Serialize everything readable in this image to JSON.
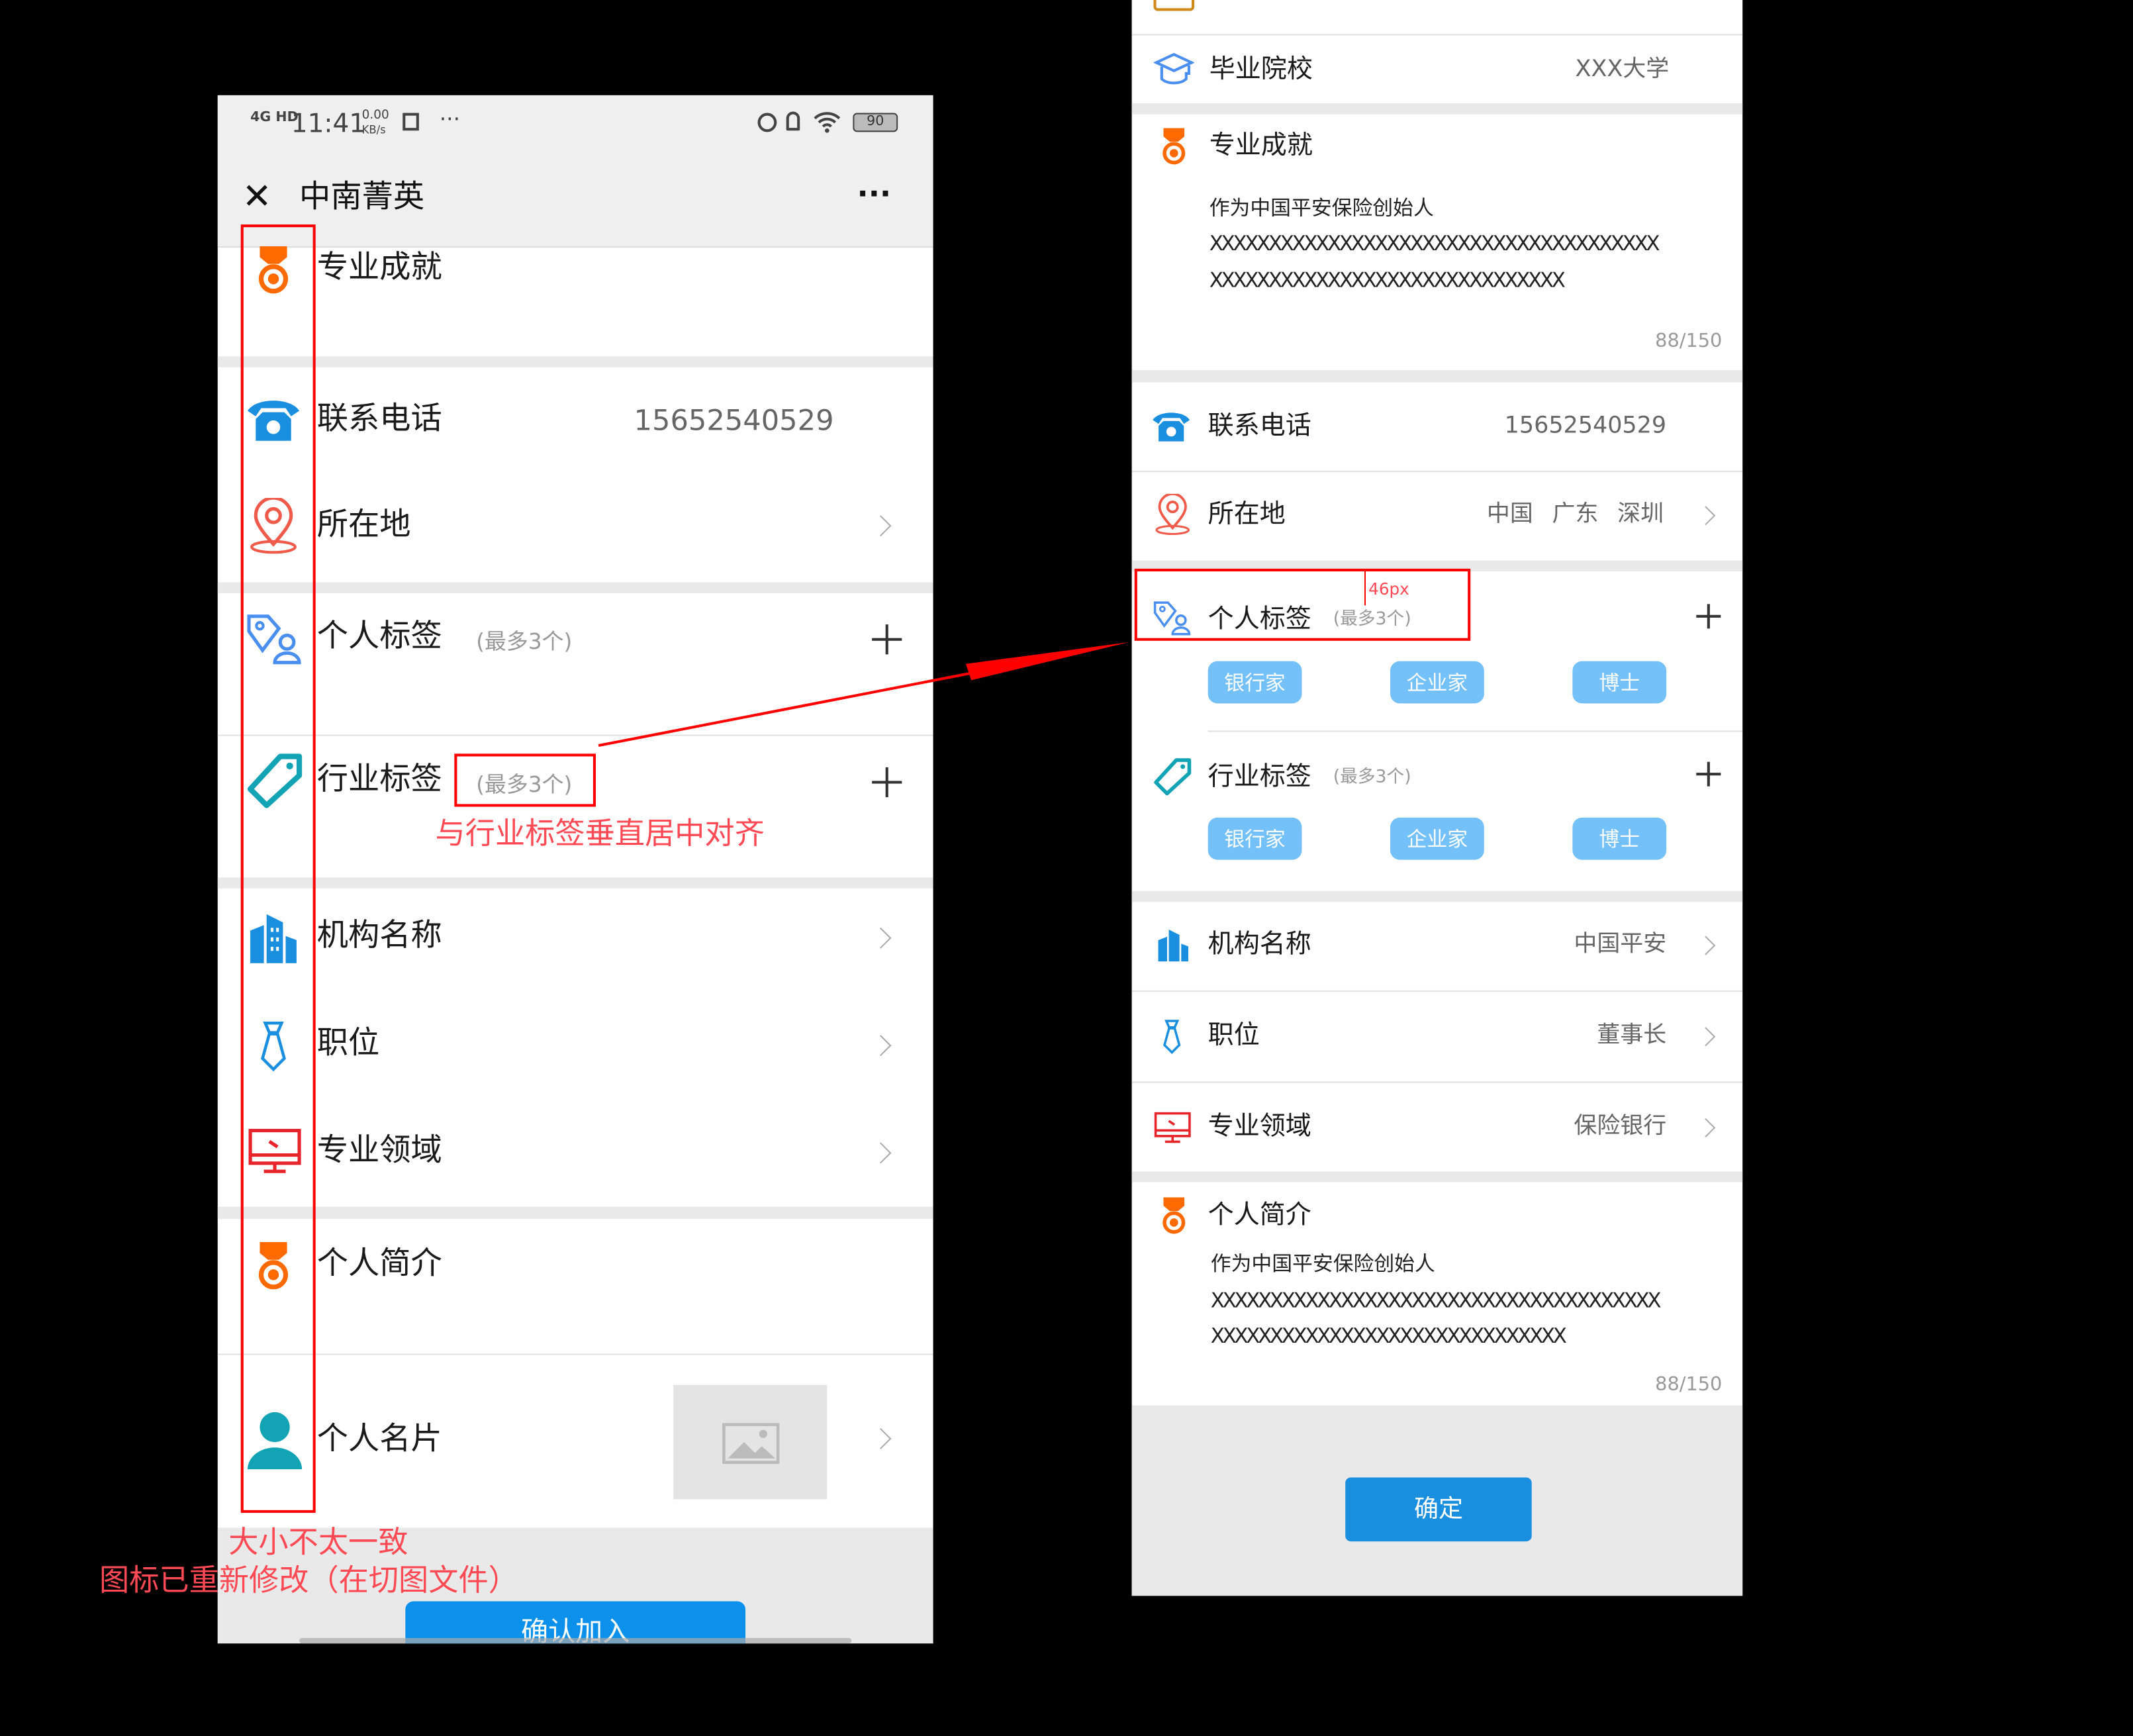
{
  "left": {
    "status": {
      "network": "4G HD",
      "time": "11:41",
      "speed_top": "0.00",
      "speed_unit": "KB/s",
      "battery": "90",
      "more": "···"
    },
    "nav": {
      "close": "✕",
      "title": "中南菁英",
      "more": "···"
    },
    "rows": {
      "achievement": "专业成就",
      "phone": "联系电话",
      "phone_value": "15652540529",
      "location": "所在地",
      "personal_tags": "个人标签",
      "personal_hint": "(最多3个)",
      "industry_tags": "行业标签",
      "industry_hint": "(最多3个)",
      "org": "机构名称",
      "position": "职位",
      "field": "专业领域",
      "intro": "个人简介",
      "card": "个人名片"
    },
    "confirm_button": "确认加入"
  },
  "annotations": {
    "align_note": "与行业标签垂直居中对齐",
    "size_note": "大小不太一致",
    "icon_note": "图标已重新修改（在切图文件）",
    "spacing": "46px",
    "color": "#ff4a55"
  },
  "right": {
    "rows": {
      "school": "毕业院校",
      "school_value": "XXX大学",
      "achievement": "专业成就",
      "achievement_lines": [
        "作为中国平安保险创始人",
        "XXXXXXXXXXXXXXXXXXXXXXXXXXXXXXXXXXXXXX",
        "XXXXXXXXXXXXXXXXXXXXXXXXXXXXXX"
      ],
      "achievement_count": "88/150",
      "phone": "联系电话",
      "phone_value": "15652540529",
      "location": "所在地",
      "location_values": [
        "中国",
        "广东",
        "深圳"
      ],
      "personal_tags": "个人标签",
      "personal_hint": "(最多3个)",
      "personal_tag_items": [
        "银行家",
        "企业家",
        "博士"
      ],
      "industry_tags": "行业标签",
      "industry_hint": "(最多3个)",
      "industry_tag_items": [
        "银行家",
        "企业家",
        "博士"
      ],
      "org": "机构名称",
      "org_value": "中国平安",
      "position": "职位",
      "position_value": "董事长",
      "field": "专业领域",
      "field_value": "保险银行",
      "intro": "个人简介",
      "intro_lines": [
        "作为中国平安保险创始人",
        "XXXXXXXXXXXXXXXXXXXXXXXXXXXXXXXXXXXXXX",
        "XXXXXXXXXXXXXXXXXXXXXXXXXXXXXX"
      ],
      "intro_count": "88/150"
    },
    "confirm_button": "确定"
  },
  "colors": {
    "primary": "#1a8fe0",
    "tag": "#74c0f9",
    "medal": "#ff6a00",
    "annotation_red": "#ff0000"
  }
}
